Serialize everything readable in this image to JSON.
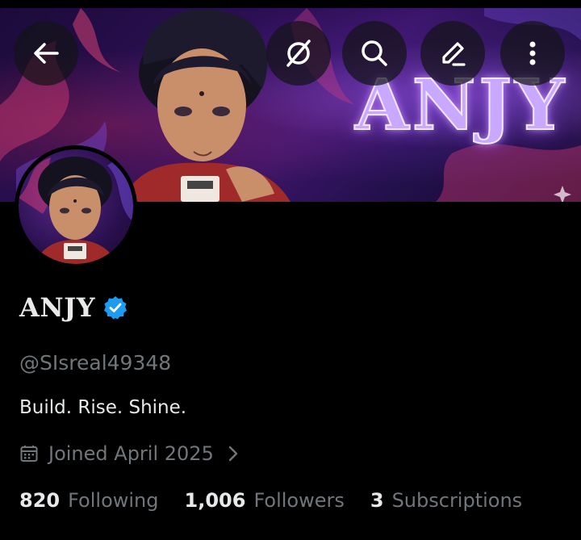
{
  "header": {
    "banner_title": "ANJY",
    "buttons": {
      "back": "back-arrow-icon",
      "grok": "grok-icon",
      "search": "search-icon",
      "edit": "edit-pencil-icon",
      "more": "more-vertical-icon"
    }
  },
  "profile": {
    "display_name": "ANJY",
    "verified": true,
    "handle": "@SIsreal49348",
    "bio": "Build. Rise. Shine.",
    "joined": "Joined April 2025"
  },
  "stats": [
    {
      "value": "820",
      "label": "Following"
    },
    {
      "value": "1,006",
      "label": "Followers"
    },
    {
      "value": "3",
      "label": "Subscriptions"
    }
  ],
  "colors": {
    "background": "#000000",
    "primary_text": "#e7e9ea",
    "secondary_text": "#71767b",
    "verified_blue": "#1d9bf0",
    "banner_purple": "#3a1468"
  }
}
